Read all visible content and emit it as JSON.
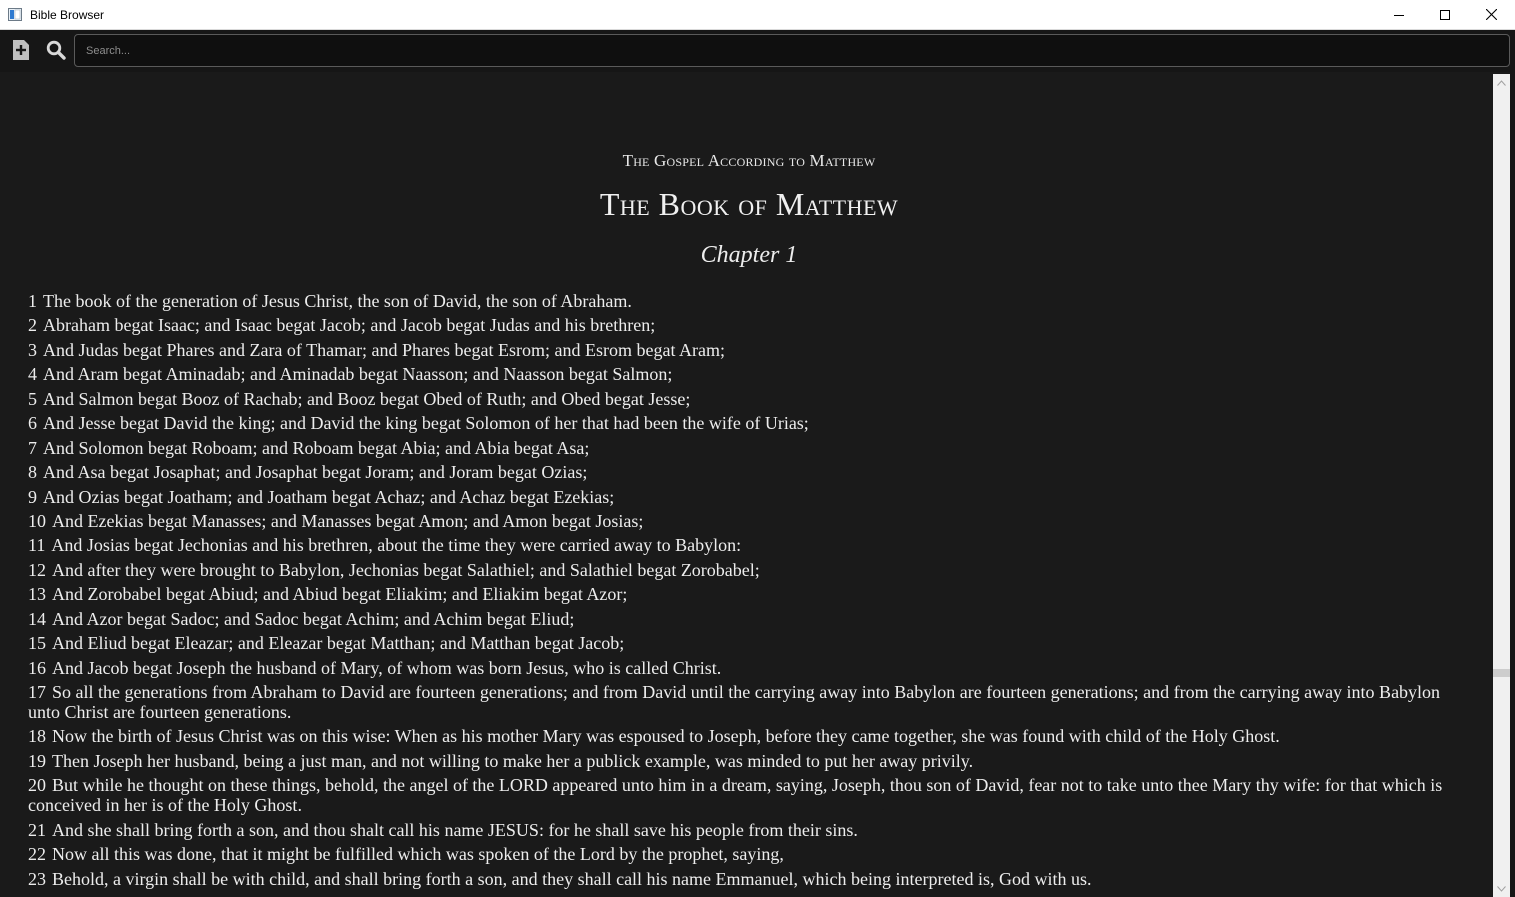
{
  "window": {
    "title": "Bible Browser",
    "controls": {
      "minimize": "minimize-icon",
      "maximize": "maximize-icon",
      "close": "close-icon"
    }
  },
  "toolbar": {
    "add_icon": "add-document-icon",
    "search_icon": "search-icon",
    "search_placeholder": "Search...",
    "search_value": ""
  },
  "reader": {
    "book_subtitle": "The Gospel According to Matthew",
    "book_title": "The Book of Matthew",
    "chapter_title": "Chapter 1",
    "verses": [
      {
        "num": "1",
        "text": "The book of the generation of Jesus Christ, the son of David, the son of Abraham."
      },
      {
        "num": "2",
        "text": "Abraham begat Isaac; and Isaac begat Jacob; and Jacob begat Judas and his brethren;"
      },
      {
        "num": "3",
        "text": "And Judas begat Phares and Zara of Thamar; and Phares begat Esrom; and Esrom begat Aram;"
      },
      {
        "num": "4",
        "text": "And Aram begat Aminadab; and Aminadab begat Naasson; and Naasson begat Salmon;"
      },
      {
        "num": "5",
        "text": "And Salmon begat Booz of Rachab; and Booz begat Obed of Ruth; and Obed begat Jesse;"
      },
      {
        "num": "6",
        "text": "And Jesse begat David the king; and David the king begat Solomon of her that had been the wife of Urias;"
      },
      {
        "num": "7",
        "text": "And Solomon begat Roboam; and Roboam begat Abia; and Abia begat Asa;"
      },
      {
        "num": "8",
        "text": "And Asa begat Josaphat; and Josaphat begat Joram; and Joram begat Ozias;"
      },
      {
        "num": "9",
        "text": "And Ozias begat Joatham; and Joatham begat Achaz; and Achaz begat Ezekias;"
      },
      {
        "num": "10",
        "text": "And Ezekias begat Manasses; and Manasses begat Amon; and Amon begat Josias;"
      },
      {
        "num": "11",
        "text": "And Josias begat Jechonias and his brethren, about the time they were carried away to Babylon:"
      },
      {
        "num": "12",
        "text": "And after they were brought to Babylon, Jechonias begat Salathiel; and Salathiel begat Zorobabel;"
      },
      {
        "num": "13",
        "text": "And Zorobabel begat Abiud; and Abiud begat Eliakim; and Eliakim begat Azor;"
      },
      {
        "num": "14",
        "text": "And Azor begat Sadoc; and Sadoc begat Achim; and Achim begat Eliud;"
      },
      {
        "num": "15",
        "text": "And Eliud begat Eleazar; and Eleazar begat Matthan; and Matthan begat Jacob;"
      },
      {
        "num": "16",
        "text": "And Jacob begat Joseph the husband of Mary, of whom was born Jesus, who is called Christ."
      },
      {
        "num": "17",
        "text": "So all the generations from Abraham to David are fourteen generations; and from David until the carrying away into Babylon are fourteen generations; and from the carrying away into Babylon unto Christ are fourteen generations."
      },
      {
        "num": "18",
        "text": "Now the birth of Jesus Christ was on this wise: When as his mother Mary was espoused to Joseph, before they came together, she was found with child of the Holy Ghost."
      },
      {
        "num": "19",
        "text": "Then Joseph her husband, being a just man, and not willing to make her a publick example, was minded to put her away privily."
      },
      {
        "num": "20",
        "text": "But while he thought on these things, behold, the angel of the LORD appeared unto him in a dream, saying, Joseph, thou son of David, fear not to take unto thee Mary thy wife: for that which is conceived in her is of the Holy Ghost."
      },
      {
        "num": "21",
        "text": "And she shall bring forth a son, and thou shalt call his name JESUS: for he shall save his people from their sins."
      },
      {
        "num": "22",
        "text": "Now all this was done, that it might be fulfilled which was spoken of the Lord by the prophet, saying,"
      },
      {
        "num": "23",
        "text": "Behold, a virgin shall be with child, and shall bring forth a son, and they shall call his name Emmanuel, which being interpreted is, God with us."
      }
    ]
  },
  "scrollbar": {
    "position": 0.72
  },
  "colors": {
    "background": "#1a1a1a",
    "text": "#ececec",
    "titlebar": "#ffffff",
    "toolbar": "#161616"
  }
}
